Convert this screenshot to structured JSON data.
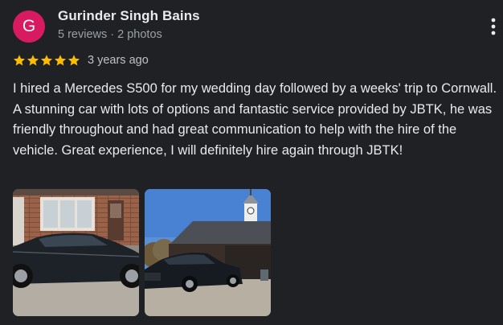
{
  "author": {
    "initial": "G",
    "name": "Gurinder Singh Bains",
    "meta": "5 reviews · 2 photos",
    "avatar_color": "#d81b60"
  },
  "rating": {
    "stars": 5,
    "max_stars": 5,
    "star_color": "#fbbc04"
  },
  "review": {
    "date": "3 years ago",
    "text": "I hired a Mercedes S500 for my wedding day followed by a weeks' trip to Cornwall. A stunning car with lots of options and fantastic service provided by JBTK, he was friendly throughout and had great communication to help with the hire of the vehicle. Great experience, I will definitely hire again through JBTK!"
  },
  "photos": [
    {
      "icon": "photo-car-driveway-house"
    },
    {
      "icon": "photo-car-coach-house"
    }
  ],
  "actions": {
    "more_icon": "more-vert-icon"
  }
}
